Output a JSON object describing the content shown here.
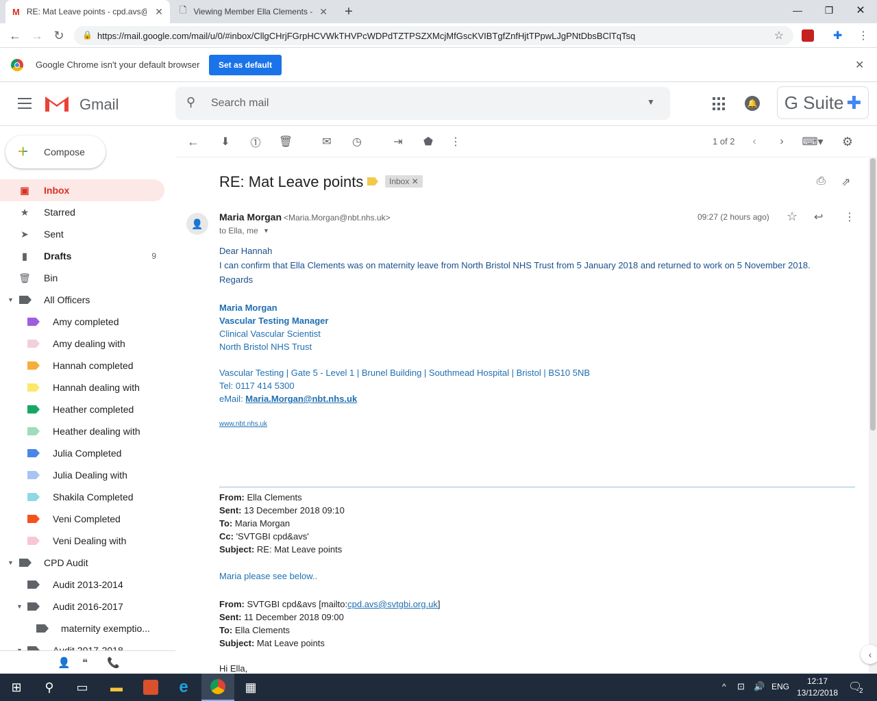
{
  "tabs": [
    {
      "label": "RE: Mat Leave points - cpd.avs@"
    },
    {
      "label": "Viewing Member Ella Clements -"
    }
  ],
  "address": {
    "url": "https://mail.google.com/mail/u/0/#inbox/CllgCHrjFGrpHCVWkTHVPcWDPdTZTPSZXMcjMfGscKVIBTgfZnfHjtTPpwLJgPNtDbsBClTqTsq"
  },
  "infobar": {
    "message": "Google Chrome isn't your default browser",
    "button": "Set as default"
  },
  "gmail": {
    "logo_text": "Gmail",
    "search_placeholder": "Search mail",
    "gsuite": "G Suite"
  },
  "compose": {
    "label": "Compose"
  },
  "sidebar": {
    "items": [
      {
        "label": "Inbox"
      },
      {
        "label": "Starred"
      },
      {
        "label": "Sent"
      },
      {
        "label": "Drafts",
        "count": "9"
      },
      {
        "label": "Bin"
      },
      {
        "label": "All Officers"
      },
      {
        "label": "Amy completed",
        "color": "#a05de0"
      },
      {
        "label": "Amy dealing with",
        "color": "#f2d0d9"
      },
      {
        "label": "Hannah completed",
        "color": "#f6ad3b"
      },
      {
        "label": "Hannah dealing with",
        "color": "#fce769"
      },
      {
        "label": "Heather completed",
        "color": "#16a765"
      },
      {
        "label": "Heather dealing with",
        "color": "#9fdcbc"
      },
      {
        "label": "Julia Completed",
        "color": "#4a86e8"
      },
      {
        "label": "Julia Dealing with",
        "color": "#a7c4f2"
      },
      {
        "label": "Shakila Completed",
        "color": "#8fd8e6"
      },
      {
        "label": "Veni Completed",
        "color": "#f4511e"
      },
      {
        "label": "Veni Dealing with",
        "color": "#f7c8d3"
      },
      {
        "label": "CPD Audit"
      },
      {
        "label": "Audit 2013-2014"
      },
      {
        "label": "Audit 2016-2017"
      },
      {
        "label": "maternity exemptio..."
      },
      {
        "label": "Audit 2017-2018"
      }
    ]
  },
  "toolbar": {
    "pager": "1 of 2"
  },
  "message": {
    "subject": "RE: Mat Leave points",
    "label": "Inbox",
    "sender_name": "Maria Morgan",
    "sender_email": "<Maria.Morgan@nbt.nhs.uk>",
    "to": "to Ella, me",
    "time": "09:27 (2 hours ago)",
    "greeting": "Dear Hannah",
    "line1": "I can confirm that Ella Clements was on maternity leave from North Bristol NHS Trust from 5 January 2018 and returned to work  on 5 November 2018.",
    "regards": "Regards",
    "sig_name": "Maria Morgan",
    "sig_title": "Vascular Testing Manager",
    "sig_role": "Clinical Vascular Scientist",
    "sig_org": "North Bristol NHS Trust",
    "sig_address": "Vascular Testing | Gate 5 - Level 1 | Brunel Building | Southmead Hospital | Bristol | BS10 5NB",
    "sig_tel": "Tel: 0117 414 5300",
    "sig_email_label": "eMail: ",
    "sig_email": "Maria.Morgan@nbt.nhs.uk",
    "sig_web": "www.nbt.nhs.uk",
    "q1_from_label": "From:",
    "q1_from": " Ella Clements",
    "q1_sent_label": "Sent:",
    "q1_sent": " 13 December 2018 09:10",
    "q1_to_label": "To:",
    "q1_to": " Maria Morgan",
    "q1_cc_label": "Cc:",
    "q1_cc": " 'SVTGBI cpd&avs'",
    "q1_subject_label": "Subject:",
    "q1_subject": " RE: Mat Leave points",
    "q1_body": "Maria please see below..",
    "q2_from_label": "From:",
    "q2_from": " SVTGBI cpd&avs [mailto:",
    "q2_from_link": "cpd.avs@svtgbi.org.uk",
    "q2_from_end": "]",
    "q2_sent_label": "Sent:",
    "q2_sent": " 11 December 2018 09:00",
    "q2_to_label": "To:",
    "q2_to": " Ella Clements",
    "q2_subject_label": "Subject:",
    "q2_subject": " Mat Leave points",
    "q2_body": "Hi Ella,"
  },
  "taskbar": {
    "lang": "ENG",
    "time": "12:17",
    "date": "13/12/2018",
    "notif": "2"
  }
}
